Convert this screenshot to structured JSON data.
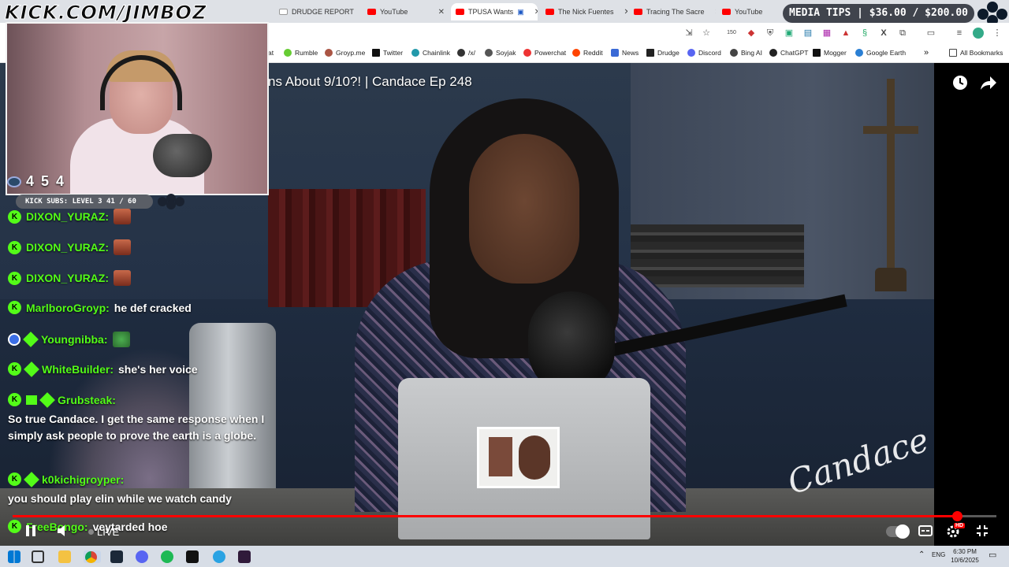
{
  "browser": {
    "tabs": [
      {
        "label": "DRUDGE REPORT",
        "active": false
      },
      {
        "label": "YouTube",
        "active": false
      },
      {
        "label": "TPUSA Wants",
        "active": true
      },
      {
        "label": "The Nick Fuentes",
        "active": false
      },
      {
        "label": "Tracing The Sacre",
        "active": false
      },
      {
        "label": "YouTube",
        "active": false
      }
    ],
    "bookmarks": [
      "Rumble",
      "Groyp.me",
      "Twitter",
      "Chainlink",
      "/x/",
      "Soyjak",
      "Powerchat",
      "Reddit",
      "News",
      "Drudge",
      "Discord",
      "Bing AI",
      "ChatGPT",
      "Mogger",
      "Google Earth"
    ],
    "bookmark_partial": "at",
    "all_bookmarks_label": "All Bookmarks",
    "extension_badge": "150"
  },
  "media_tips": "MEDIA TIPS | $36.00 / $200.00",
  "stream": {
    "brand": "KICK.COM/JIMBOZ",
    "viewer_count": "4 5 4",
    "subs_goal": "KICK SUBS: LEVEL 3 41 / 60"
  },
  "video": {
    "title": "ns About 9/10?! | Candace Ep 248",
    "signature": "Candace",
    "progress_fraction": 0.96,
    "live_label": "LIVE",
    "quality_badge": "HD"
  },
  "chat": [
    {
      "user": "DIXON_YURAZ:",
      "text": "",
      "emote": true
    },
    {
      "user": "DIXON_YURAZ:",
      "text": "",
      "emote": true
    },
    {
      "user": "DIXON_YURAZ:",
      "text": "",
      "emote": true
    },
    {
      "user": "MarlboroGroyp:",
      "text": "he def cracked"
    },
    {
      "user": "Youngnibba:",
      "text": "",
      "emote": true
    },
    {
      "user": "WhiteBuilder:",
      "text": "she's her voice"
    },
    {
      "user": "Grubsteak:",
      "text": "So true Candace. I get the same response when I simply ask people to prove the earth is a globe."
    },
    {
      "user": "k0kichigroyper:",
      "text": "you should play elin while we watch candy"
    },
    {
      "user": "FreeBongo:",
      "text": "veytarded hoe"
    }
  ],
  "taskbar": {
    "lang": "ENG",
    "time": "6:30 PM",
    "date": "10/6/2025"
  },
  "colors": {
    "kick_green": "#53fc18",
    "progress_red": "#ff0000",
    "tabbar_bg": "#dee1e6"
  }
}
